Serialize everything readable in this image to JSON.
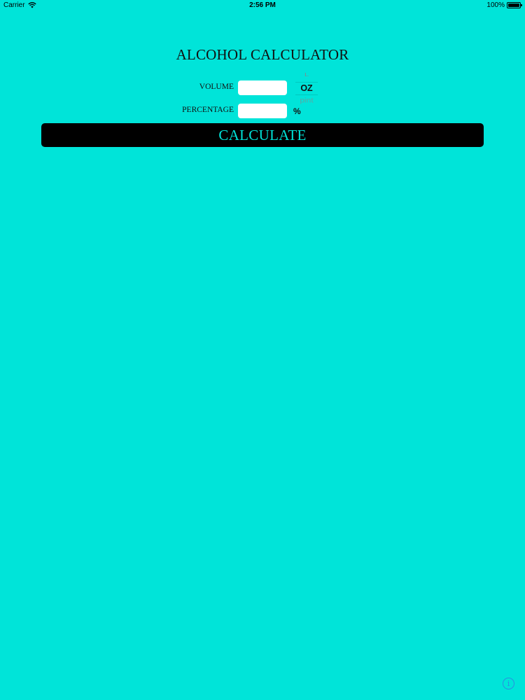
{
  "status_bar": {
    "carrier": "Carrier",
    "time": "2:56 PM",
    "battery": "100%"
  },
  "title": "ALCOHOL CALCULATOR",
  "form": {
    "volume_label": "VOLUME",
    "volume_value": "",
    "percentage_label": "PERCENTAGE",
    "percentage_value": "",
    "unit_picker": {
      "above": "L",
      "selected": "OZ",
      "below": "pint"
    },
    "percent_sign": "%"
  },
  "calculate_label": "CALCULATE",
  "info_icon_glyph": "i",
  "colors": {
    "background": "#00e4d9",
    "button": "#000000",
    "button_text": "#00e4d9",
    "info_icon": "#2b8fe0"
  }
}
